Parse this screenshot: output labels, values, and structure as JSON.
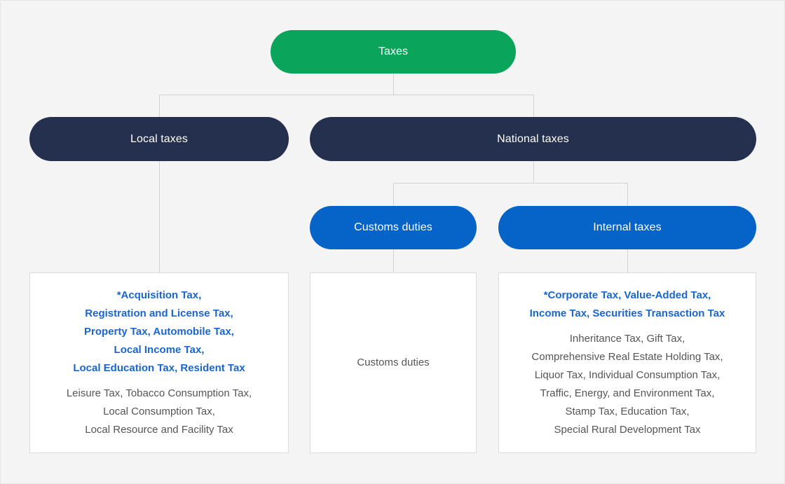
{
  "diagram": {
    "title": "Taxes classification tree",
    "background_color": "#f4f4f4",
    "connector_color": "#d2d2d2"
  },
  "colors": {
    "root": "#0aa45a",
    "level2": "#252f4e",
    "level3": "#0663c8",
    "primary_text": "#1a66cc",
    "secondary_text": "#555555",
    "box_border": "#dcdcdc",
    "box_background": "#ffffff"
  },
  "nodes": {
    "root": {
      "label": "Taxes"
    },
    "local_taxes": {
      "label": "Local taxes"
    },
    "national_taxes": {
      "label": "National taxes"
    },
    "customs_duties": {
      "label": "Customs duties"
    },
    "internal_taxes": {
      "label": "Internal taxes"
    }
  },
  "details": {
    "local": {
      "primary": "*Acquisition Tax,\nRegistration and License Tax,\nProperty Tax, Automobile Tax,\nLocal Income Tax,\nLocal Education Tax, Resident Tax",
      "secondary": "Leisure Tax, Tobacco Consumption Tax,\nLocal Consumption Tax,\nLocal Resource and Facility Tax"
    },
    "customs": {
      "plain": "Customs duties"
    },
    "internal": {
      "primary": "*Corporate Tax, Value-Added Tax,\nIncome Tax, Securities Transaction Tax",
      "secondary": "Inheritance Tax, Gift Tax,\nComprehensive Real Estate Holding Tax,\nLiquor Tax, Individual Consumption Tax,\nTraffic, Energy, and Environment Tax,\nStamp Tax, Education Tax,\nSpecial Rural Development Tax"
    }
  }
}
